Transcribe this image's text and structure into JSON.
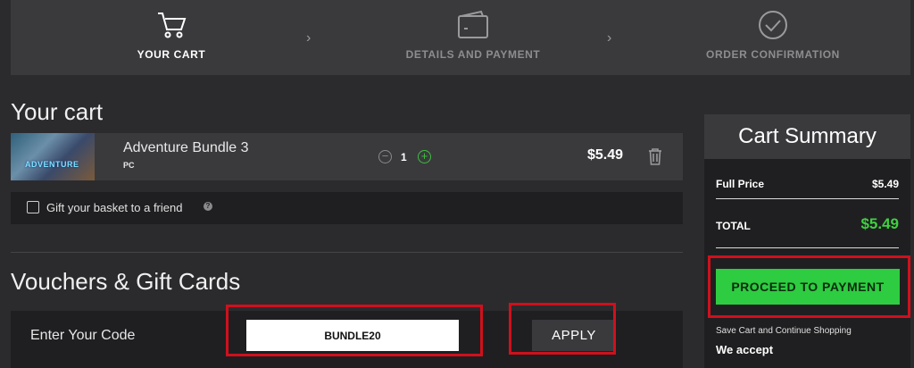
{
  "steps": [
    {
      "label": "YOUR CART",
      "icon": "shopping-cart-icon"
    },
    {
      "label": "DETAILS AND PAYMENT",
      "icon": "wallet-icon"
    },
    {
      "label": "ORDER CONFIRMATION",
      "icon": "check-circle-icon"
    }
  ],
  "cart": {
    "title": "Your cart",
    "item": {
      "name": "Adventure Bundle 3",
      "platform": "PC",
      "thumbnail_text": "ADVENTURE",
      "quantity": "1",
      "price": "$5.49"
    },
    "gift_label": "Gift your basket to a friend",
    "help_icon": "?"
  },
  "vouchers": {
    "title": "Vouchers & Gift Cards",
    "label": "Enter Your Code",
    "code_value": "BUNDLE20",
    "apply_label": "APPLY"
  },
  "summary": {
    "title": "Cart Summary",
    "full_price_label": "Full Price",
    "full_price_value": "$5.49",
    "total_label": "TOTAL",
    "total_value": "$5.49",
    "proceed_label": "PROCEED TO PAYMENT",
    "save_label": "Save Cart and Continue Shopping",
    "accept_label": "We accept"
  },
  "colors": {
    "background": "#2b2b2e",
    "panel": "#3a3a3d",
    "dark_panel": "#1f1f21",
    "accent_green": "#2ecc40",
    "total_green": "#3fd13f",
    "highlight_red": "#d0101c"
  }
}
